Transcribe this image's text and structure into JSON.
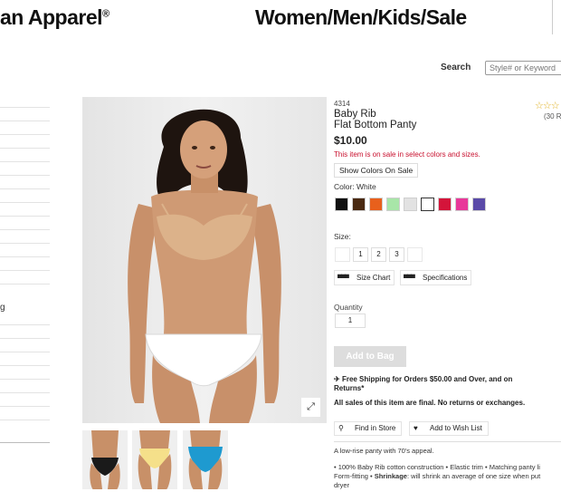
{
  "brand": {
    "name": "an Apparel",
    "mark": "®"
  },
  "nav": {
    "women": "Women",
    "sep1": "/",
    "men": "Men",
    "sep2": "/",
    "kids": "Kids",
    "sep3": "/",
    "sale": "Sale"
  },
  "search": {
    "label": "Search",
    "placeholder": "Style# or Keyword"
  },
  "sidebar": {
    "partial_item": "g"
  },
  "product": {
    "sku": "4314",
    "name_line1": "Baby Rib",
    "name_line2": "Flat Bottom Panty",
    "price": "$10.00",
    "sale_message": "This item is on sale in select colors and sizes.",
    "show_colors_label": "Show Colors On Sale",
    "color_label": "Color: White",
    "rating_stars": "☆☆☆",
    "reviews_count": "(30 R",
    "swatches": [
      "#111111",
      "#4a2a12",
      "#e8601c",
      "#a8e6a8",
      "#e2e2e2",
      "#ffffff",
      "#d4143a",
      "#e8389a",
      "#5a4aa8"
    ],
    "selected_swatch_index": 5,
    "size_label": "Size:",
    "sizes": [
      "",
      "1",
      "2",
      "3",
      ""
    ],
    "size_chart_label": "Size Chart",
    "specifications_label": "Specifications",
    "quantity_label": "Quantity",
    "quantity_value": "1",
    "add_to_bag_label": "Add to Bag",
    "shipping_text": "Free Shipping for Orders $50.00 and Over, and on",
    "shipping_text2": "Returns*",
    "final_sale_text": "All sales of this item are final. No returns or exchanges.",
    "find_store_label": "Find in Store",
    "wishlist_label": "Add to Wish List",
    "description": "A low-rise panty with 70's appeal.",
    "details_line1": "• 100% Baby Rib cotton construction • Elastic trim • Matching panty li",
    "details_line2_a": "Form-fitting • ",
    "details_line2_b": "Shrinkage",
    "details_line2_c": ": will shrink an average of one size when put",
    "details_line3": "dryer"
  },
  "icons": {
    "expand": "expand-icon",
    "plane": "plane-icon",
    "pin": "map-pin-icon",
    "heart": "heart-icon",
    "ruler": "ruler-icon"
  }
}
